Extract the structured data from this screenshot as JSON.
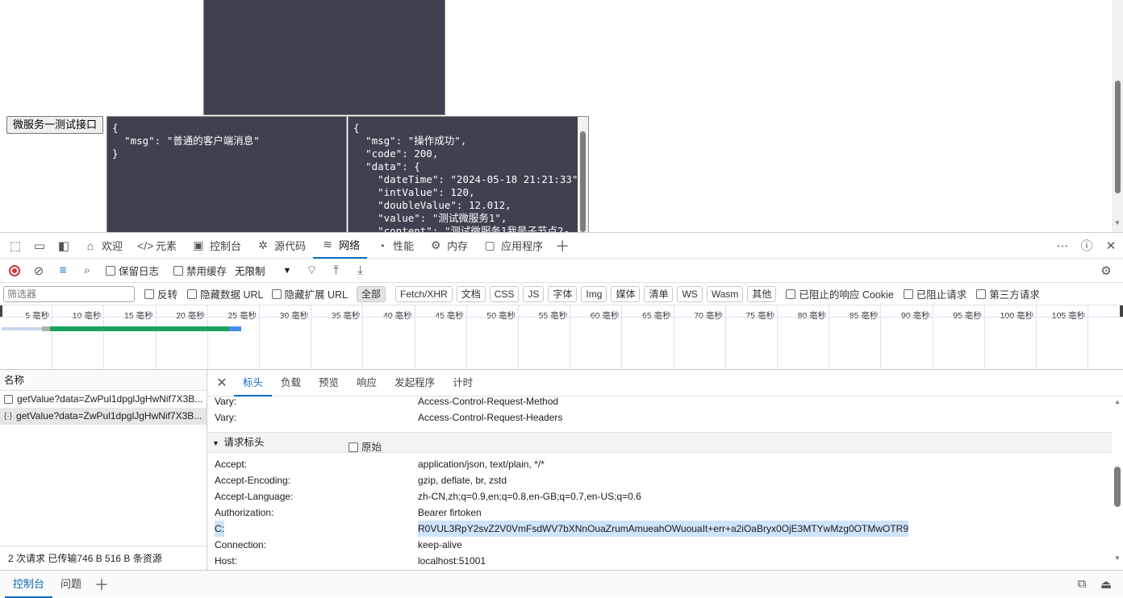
{
  "page": {
    "button_label": "微服务一测试接口",
    "request_text": "{\n  \"msg\": \"普通的客户端消息\"\n}",
    "response_text": "{\n  \"msg\": \"操作成功\",\n  \"code\": 200,\n  \"data\": {\n    \"dateTime\": \"2024-05-18 21:21:33\",\n    \"intValue\": 120,\n    \"doubleValue\": 12.012,\n    \"value\": \"测试微服务1\",\n    \"content\": \"测试微服务1我是子节点2-"
  },
  "devtools": {
    "tabs": [
      {
        "label": "欢迎",
        "icon": "home-icon"
      },
      {
        "label": "元素",
        "icon": "code-icon"
      },
      {
        "label": "控制台",
        "icon": "console-icon"
      },
      {
        "label": "源代码",
        "icon": "bug-icon"
      },
      {
        "label": "网络",
        "icon": "wifi-icon"
      },
      {
        "label": "性能",
        "icon": "gauge-icon"
      },
      {
        "label": "内存",
        "icon": "cpu-icon"
      },
      {
        "label": "应用程序",
        "icon": "app-window-icon"
      }
    ],
    "toolbar": {
      "preserve_log": "保留日志",
      "disable_cache": "禁用缓存",
      "throttle": "无限制"
    },
    "filter": {
      "placeholder": "筛选器",
      "invert": "反转",
      "hide_data_url": "隐藏数据 URL",
      "hide_ext_url": "隐藏扩展 URL",
      "types": [
        "全部",
        "Fetch/XHR",
        "文档",
        "CSS",
        "JS",
        "字体",
        "Img",
        "媒体",
        "清单",
        "WS",
        "Wasm",
        "其他"
      ],
      "blocked_cookies": "已阻止的响应 Cookie",
      "blocked_requests": "已阻止请求",
      "third_party": "第三方请求"
    },
    "timeline_ticks": [
      "5 毫秒",
      "10 毫秒",
      "15 毫秒",
      "20 毫秒",
      "25 毫秒",
      "30 毫秒",
      "35 毫秒",
      "40 毫秒",
      "45 毫秒",
      "50 毫秒",
      "55 毫秒",
      "60 毫秒",
      "65 毫秒",
      "70 毫秒",
      "75 毫秒",
      "80 毫秒",
      "85 毫秒",
      "90 毫秒",
      "95 毫秒",
      "100 毫秒",
      "105 毫秒",
      "110"
    ],
    "requests": {
      "header": "名称",
      "items": [
        "getValue?data=ZwPul1dpglJgHwNif7X3B...",
        "getValue?data=ZwPul1dpglJgHwNif7X3B..."
      ],
      "status": "2 次请求  已传输746 B  516 B 条资源"
    },
    "detail": {
      "tabs": [
        "标头",
        "负载",
        "预览",
        "响应",
        "发起程序",
        "计时"
      ],
      "response_headers": [
        {
          "name": "Vary:",
          "value": "Access-Control-Request-Method"
        },
        {
          "name": "Vary:",
          "value": "Access-Control-Request-Headers"
        }
      ],
      "section_title": "请求标头",
      "raw_label": "原始",
      "request_headers": [
        {
          "name": "Accept:",
          "value": "application/json, text/plain, */*"
        },
        {
          "name": "Accept-Encoding:",
          "value": "gzip, deflate, br, zstd"
        },
        {
          "name": "Accept-Language:",
          "value": "zh-CN,zh;q=0.9,en;q=0.8,en-GB;q=0.7,en-US;q=0.6"
        },
        {
          "name": "Authorization:",
          "value": "Bearer firtoken"
        },
        {
          "name": "C:",
          "value": "R0VUL3RpY2svZ2V0VmFsdWV7bXNnOuaZrumAmueahOWuouaIt+err+a2iOaBryx0OjE3MTYwMzg0OTMwOTR9"
        },
        {
          "name": "Connection:",
          "value": "keep-alive"
        },
        {
          "name": "Host:",
          "value": "localhost:51001"
        }
      ]
    },
    "drawer_tabs": [
      "控制台",
      "问题"
    ]
  }
}
